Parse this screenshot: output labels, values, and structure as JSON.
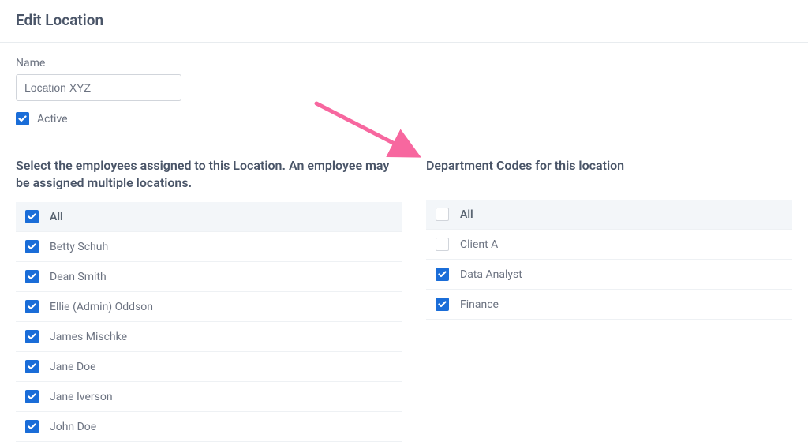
{
  "header": {
    "title": "Edit Location"
  },
  "form": {
    "name_label": "Name",
    "name_value": "Location XYZ",
    "active_label": "Active",
    "active_checked": true
  },
  "employees": {
    "heading": "Select the employees assigned to this Location. An employee may be assigned multiple locations.",
    "items": [
      {
        "label": "All",
        "checked": true,
        "first": true
      },
      {
        "label": "Betty Schuh",
        "checked": true
      },
      {
        "label": "Dean Smith",
        "checked": true
      },
      {
        "label": "Ellie (Admin) Oddson",
        "checked": true
      },
      {
        "label": "James Mischke",
        "checked": true
      },
      {
        "label": "Jane Doe",
        "checked": true
      },
      {
        "label": "Jane Iverson",
        "checked": true
      },
      {
        "label": "John Doe",
        "checked": true
      }
    ]
  },
  "departments": {
    "heading": "Department Codes for this location",
    "items": [
      {
        "label": "All",
        "checked": false,
        "first": true
      },
      {
        "label": "Client A",
        "checked": false
      },
      {
        "label": "Data Analyst",
        "checked": true
      },
      {
        "label": "Finance",
        "checked": true
      }
    ]
  },
  "colors": {
    "accent": "#1a6dd8",
    "annotation": "#f7679f"
  }
}
